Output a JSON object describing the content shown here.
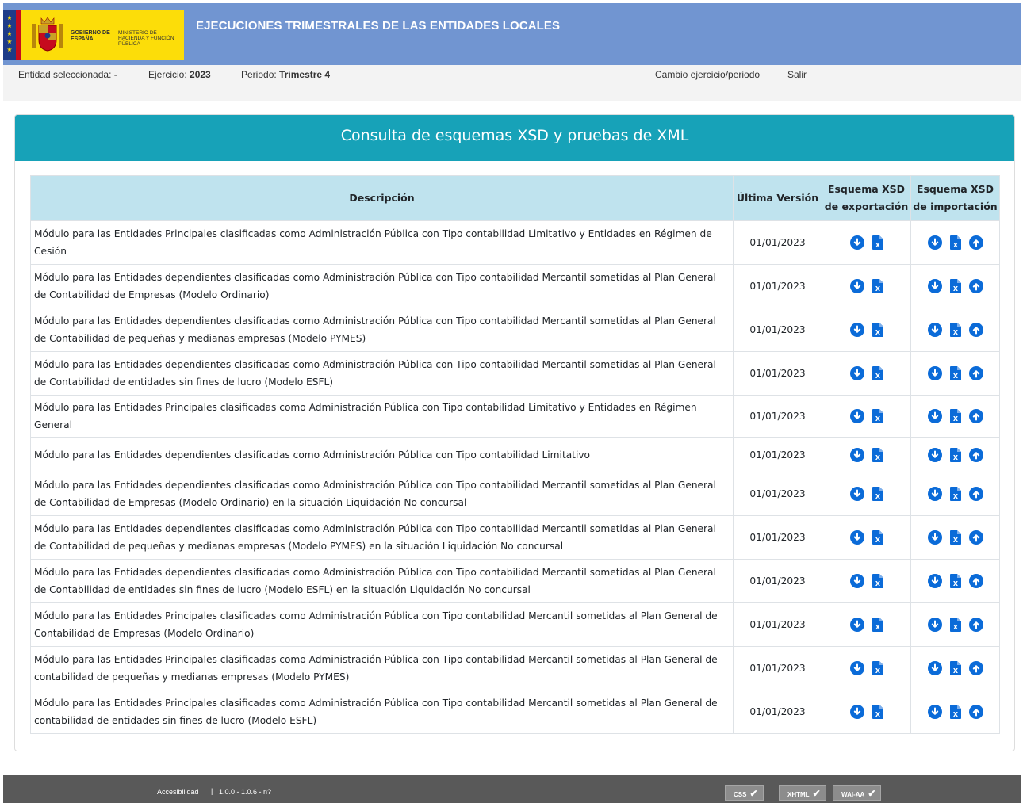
{
  "header": {
    "logo_line1": "GOBIERNO DE ESPAÑA",
    "logo_line2": "MINISTERIO DE HACIENDA Y FUNCIÓN PÚBLICA",
    "title": "EJECUCIONES TRIMESTRALES DE LAS ENTIDADES LOCALES",
    "brand_color": "#7195d1"
  },
  "infobar": {
    "entidad_label": "Entidad seleccionada:",
    "entidad_value": "-",
    "ejercicio_label": "Ejercicio:",
    "ejercicio_value": "2023",
    "periodo_label": "Periodo:",
    "periodo_value": "Trimestre 4",
    "cambio_link": "Cambio ejercicio/periodo",
    "salir_link": "Salir"
  },
  "panel": {
    "title": "Consulta de esquemas XSD y pruebas de XML",
    "header_color": "#17a2b8"
  },
  "table": {
    "headers": {
      "descripcion": "Descripción",
      "version": "Última Versión",
      "export_line1": "Esquema XSD",
      "export_line2": "de exportación",
      "import_line1": "Esquema XSD",
      "import_line2": "de importación"
    },
    "rows": [
      {
        "desc": "Módulo para las Entidades Principales clasificadas como Administración Pública con Tipo contabilidad Limitativo y Entidades en Régimen de Cesión",
        "version": "01/01/2023"
      },
      {
        "desc": "Módulo para las Entidades dependientes clasificadas como Administración Pública con Tipo contabilidad Mercantil sometidas al Plan General de Contabilidad de Empresas (Modelo Ordinario)",
        "version": "01/01/2023"
      },
      {
        "desc": "Módulo para las Entidades dependientes clasificadas como Administración Pública con Tipo contabilidad Mercantil sometidas al Plan General de Contabilidad de pequeñas y medianas empresas (Modelo PYMES)",
        "version": "01/01/2023"
      },
      {
        "desc": "Módulo para las Entidades dependientes clasificadas como Administración Pública con Tipo contabilidad Mercantil sometidas al Plan General de Contabilidad de entidades sin fines de lucro (Modelo ESFL)",
        "version": "01/01/2023"
      },
      {
        "desc": "Módulo para las Entidades Principales clasificadas como Administración Pública con Tipo contabilidad Limitativo y Entidades en Régimen General",
        "version": "01/01/2023"
      },
      {
        "desc": "Módulo para las Entidades dependientes clasificadas como Administración Pública con Tipo contabilidad Limitativo",
        "version": "01/01/2023"
      },
      {
        "desc": "Módulo para las Entidades dependientes clasificadas como Administración Pública con Tipo contabilidad Mercantil sometidas al Plan General de Contabilidad de Empresas (Modelo Ordinario) en la situación Liquidación No concursal",
        "version": "01/01/2023"
      },
      {
        "desc": "Módulo para las Entidades dependientes clasificadas como Administración Pública con Tipo contabilidad Mercantil sometidas al Plan General de Contabilidad de pequeñas y medianas empresas (Modelo PYMES) en la situación Liquidación No concursal",
        "version": "01/01/2023"
      },
      {
        "desc": "Módulo para las Entidades dependientes clasificadas como Administración Pública con Tipo contabilidad Mercantil sometidas al Plan General de Contabilidad de entidades sin fines de lucro (Modelo ESFL) en la situación Liquidación No concursal",
        "version": "01/01/2023"
      },
      {
        "desc": "Módulo para las Entidades Principales clasificadas como Administración Pública con Tipo contabilidad Mercantil sometidas al Plan General de Contabilidad de Empresas (Modelo Ordinario)",
        "version": "01/01/2023"
      },
      {
        "desc": "Módulo para las Entidades Principales clasificadas como Administración Pública con Tipo contabilidad Mercantil sometidas al Plan General de contabilidad de pequeñas y medianas empresas (Modelo PYMES)",
        "version": "01/01/2023"
      },
      {
        "desc": "Módulo para las Entidades Principales clasificadas como Administración Pública con Tipo contabilidad Mercantil sometidas al Plan General de contabilidad de entidades sin fines de lucro (Modelo ESFL)",
        "version": "01/01/2023"
      }
    ],
    "icons": {
      "download": "download-circle-icon",
      "xsd_file": "xsd-file-icon",
      "upload": "upload-circle-icon"
    },
    "icon_color": "#0b6bd8",
    "header_bg": "#bfe3ee"
  },
  "footer": {
    "accesibilidad": "Accesibilidad",
    "separator": "|",
    "version": "1.0.0 - 1.0.6 - n?",
    "badges": [
      "CSS",
      "XHTML",
      "WAI-AA"
    ]
  }
}
